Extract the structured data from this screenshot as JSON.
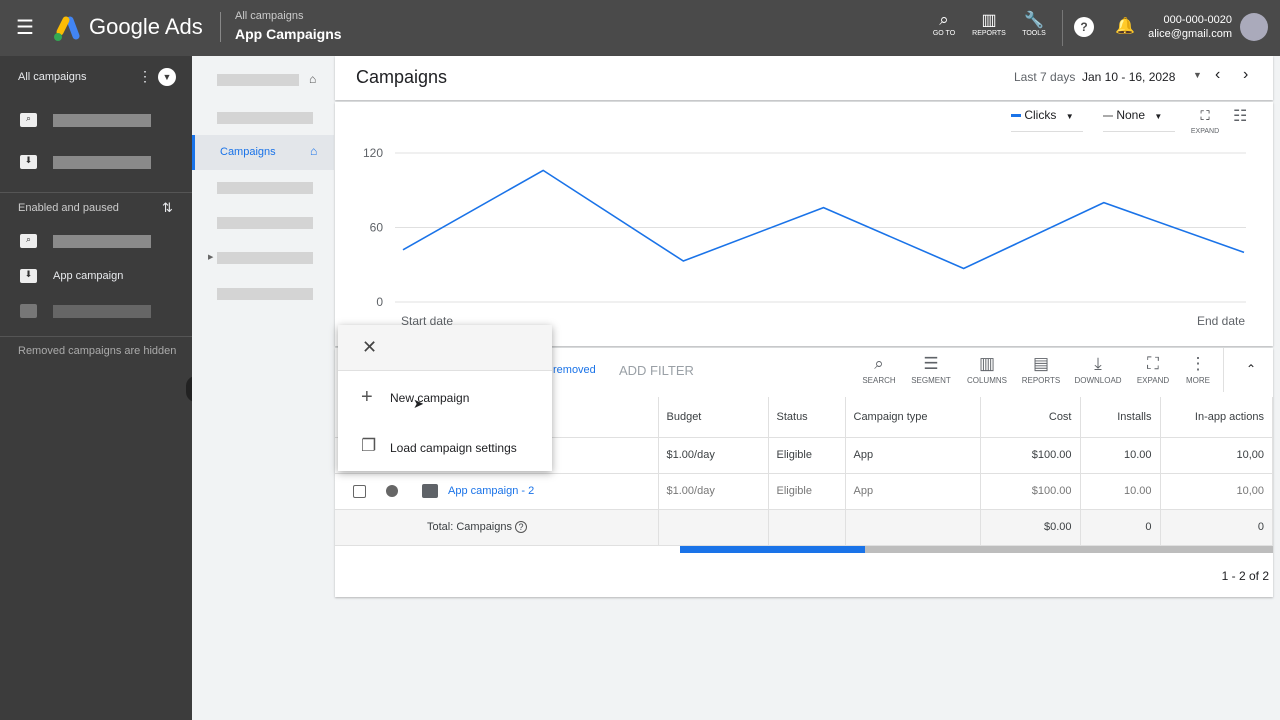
{
  "header": {
    "app_name": "Google Ads",
    "breadcrumb_parent": "All campaigns",
    "breadcrumb_current": "App Campaigns",
    "goto": "GO TO",
    "reports": "REPORTS",
    "tools": "TOOLS",
    "account_id": "000-000-0020",
    "email": "alice@gmail.com"
  },
  "sidebar": {
    "all_campaigns": "All campaigns",
    "enabled_paused": "Enabled and paused",
    "app_campaign": "App campaign",
    "removed_hidden": "Removed campaigns are hidden"
  },
  "nav": {
    "campaigns": "Campaigns"
  },
  "page": {
    "title": "Campaigns",
    "date_range_label": "Last 7 days",
    "date_range": "Jan 10 - 16, 2028"
  },
  "chart_controls": {
    "metric1": "Clicks",
    "metric2": "None",
    "expand": "EXPAND"
  },
  "chart_data": {
    "type": "line",
    "x": [
      "Start date",
      "",
      "",
      "",
      "",
      "",
      "End date"
    ],
    "xlabels": [
      "Start date",
      "End date"
    ],
    "series": [
      {
        "name": "Clicks",
        "values": [
          42,
          106,
          33,
          76,
          27,
          80,
          40
        ]
      }
    ],
    "yticks": [
      "120",
      "60",
      "0"
    ],
    "ylim": [
      0,
      120
    ],
    "grid": true,
    "color": "#1a73e8"
  },
  "filters": {
    "removed": "removed",
    "add_filter": "ADD FILTER"
  },
  "toolbar": {
    "search": "SEARCH",
    "segment": "SEGMENT",
    "columns": "COLUMNS",
    "reports": "REPORTS",
    "download": "DOWNLOAD",
    "expand": "EXPAND",
    "more": "MORE"
  },
  "menu": {
    "new_campaign": "New campaign",
    "load_settings": "Load campaign settings"
  },
  "table": {
    "headers": [
      "Budget",
      "Status",
      "Campaign type",
      "Cost",
      "Installs",
      "In-app actions"
    ],
    "rows": [
      {
        "name": "",
        "budget": "$1.00/day",
        "status": "Eligible",
        "type": "App",
        "cost": "$100.00",
        "installs": "10.00",
        "actions": "10,00"
      },
      {
        "name": "App campaign - 2",
        "budget": "$1.00/day",
        "status": "Eligible",
        "type": "App",
        "cost": "$100.00",
        "installs": "10.00",
        "actions": "10,00"
      }
    ],
    "total": {
      "label": "Total: Campaigns",
      "cost": "$0.00",
      "installs": "0",
      "actions": "0"
    }
  },
  "pagination": "1 - 2 of 2"
}
